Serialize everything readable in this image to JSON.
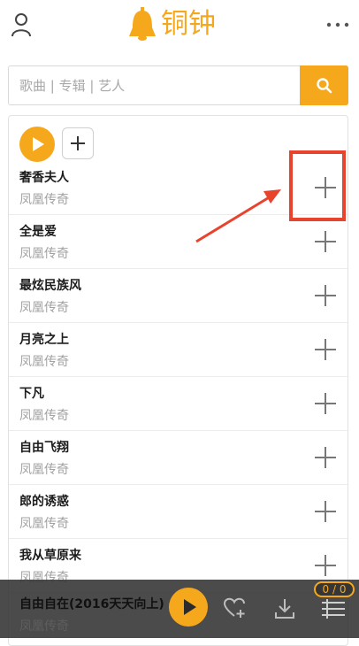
{
  "header": {
    "app_name": "铜钟",
    "brand_color": "#f5a81b",
    "icons": [
      "user-icon",
      "bell-logo-icon",
      "more-icon"
    ]
  },
  "search": {
    "placeholder": "歌曲 | 专辑 | 艺人",
    "value": "",
    "button_icon": "search-icon"
  },
  "list_toolbar": {
    "icons": [
      "play-all-icon",
      "add-all-icon"
    ]
  },
  "songs": [
    {
      "title": "奢香夫人",
      "artist": "凤凰传奇"
    },
    {
      "title": "全是爱",
      "artist": "凤凰传奇"
    },
    {
      "title": "最炫民族风",
      "artist": "凤凰传奇"
    },
    {
      "title": "月亮之上",
      "artist": "凤凰传奇"
    },
    {
      "title": "下凡",
      "artist": "凤凰传奇"
    },
    {
      "title": "自由飞翔",
      "artist": "凤凰传奇"
    },
    {
      "title": "郎的诱惑",
      "artist": "凤凰传奇"
    },
    {
      "title": "我从草原来",
      "artist": "凤凰传奇"
    }
  ],
  "annotation": {
    "color": "#e8432d",
    "target": "add button of first song"
  },
  "player": {
    "title": "自由自在(2016天天向上)",
    "artist": "凤凰传奇",
    "queue_count": "0 / 0",
    "icons": [
      "play-icon",
      "favorite-add-icon",
      "download-icon",
      "playlist-icon"
    ]
  }
}
